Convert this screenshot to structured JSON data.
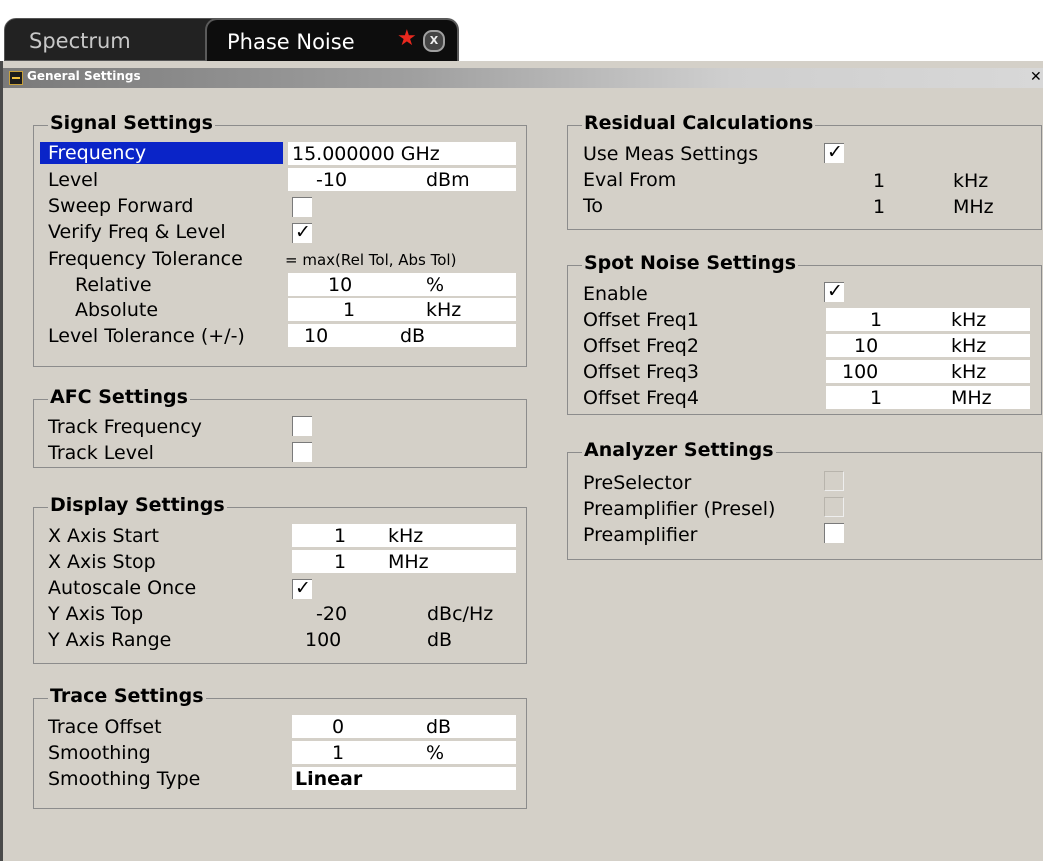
{
  "tabs": [
    {
      "label": "Spectrum"
    },
    {
      "label": "Phase Noise"
    }
  ],
  "window": {
    "title": "General Settings"
  },
  "signal": {
    "title": "Signal Settings",
    "frequency_label": "Frequency",
    "frequency_value": "15.000000 GHz",
    "level_label": "Level",
    "level_value": "-10",
    "level_unit": "dBm",
    "sweep_forward_label": "Sweep Forward",
    "verify_label": "Verify Freq & Level",
    "freq_tol_label": "Frequency Tolerance",
    "freq_tol_formula": "= max(Rel Tol, Abs Tol)",
    "relative_label": "Relative",
    "relative_value": "10",
    "relative_unit": "%",
    "absolute_label": "Absolute",
    "absolute_value": "1",
    "absolute_unit": "kHz",
    "level_tol_label": "Level Tolerance (+/-)",
    "level_tol_value": "10",
    "level_tol_unit": "dB"
  },
  "afc": {
    "title": "AFC Settings",
    "track_freq_label": "Track Frequency",
    "track_level_label": "Track Level"
  },
  "display": {
    "title": "Display Settings",
    "x_start_label": "X Axis Start",
    "x_start_value": "1",
    "x_start_unit": "kHz",
    "x_stop_label": "X Axis Stop",
    "x_stop_value": "1",
    "x_stop_unit": "MHz",
    "autoscale_label": "Autoscale Once",
    "y_top_label": "Y Axis Top",
    "y_top_value": "-20",
    "y_top_unit": "dBc/Hz",
    "y_range_label": "Y Axis Range",
    "y_range_value": "100",
    "y_range_unit": "dB"
  },
  "trace": {
    "title": "Trace Settings",
    "offset_label": "Trace Offset",
    "offset_value": "0",
    "offset_unit": "dB",
    "smoothing_label": "Smoothing",
    "smoothing_value": "1",
    "smoothing_unit": "%",
    "smoothing_type_label": "Smoothing Type",
    "smoothing_type_value": "Linear"
  },
  "residual": {
    "title": "Residual Calculations",
    "use_meas_label": "Use Meas Settings",
    "eval_from_label": "Eval From",
    "eval_from_value": "1",
    "eval_from_unit": "kHz",
    "to_label": "To",
    "to_value": "1",
    "to_unit": "MHz"
  },
  "spot": {
    "title": "Spot Noise Settings",
    "enable_label": "Enable",
    "f1_label": "Offset Freq1",
    "f1_value": "1",
    "f1_unit": "kHz",
    "f2_label": "Offset Freq2",
    "f2_value": "10",
    "f2_unit": "kHz",
    "f3_label": "Offset Freq3",
    "f3_value": "100",
    "f3_unit": "kHz",
    "f4_label": "Offset Freq4",
    "f4_value": "1",
    "f4_unit": "MHz"
  },
  "analyzer": {
    "title": "Analyzer Settings",
    "preselector_label": "PreSelector",
    "preamp_presel_label": "Preamplifier (Presel)",
    "preamp_label": "Preamplifier"
  },
  "colors": {
    "selection": "#0a24c8",
    "panel": "#d4d0c8",
    "tab_star": "#e8281e"
  }
}
